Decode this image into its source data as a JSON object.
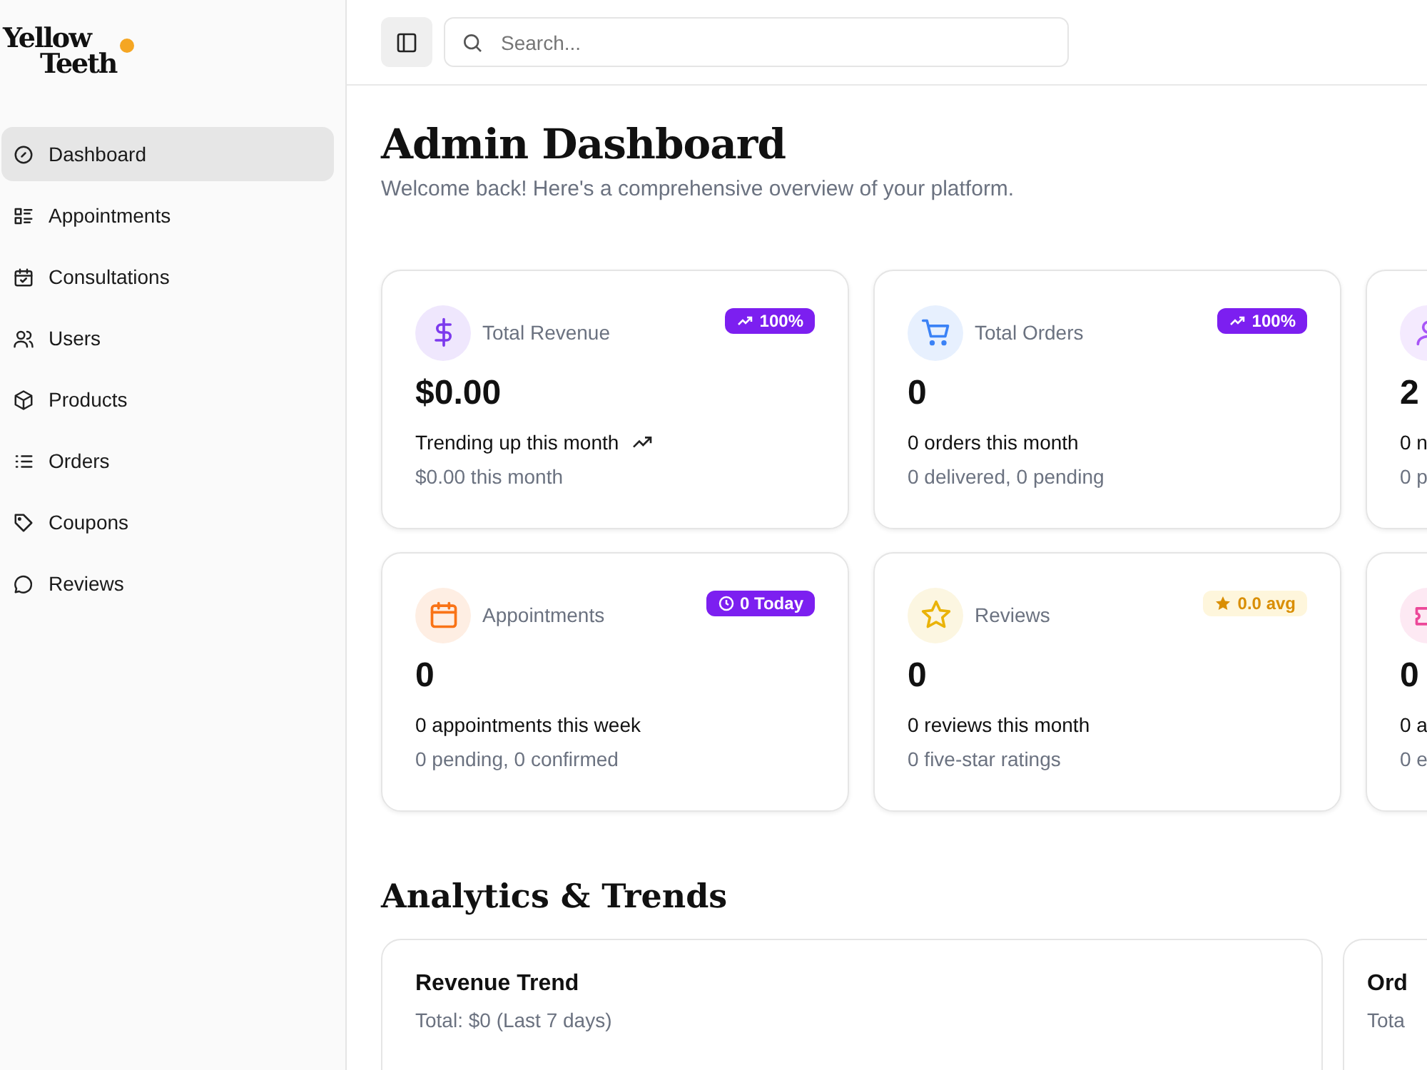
{
  "logo": {
    "line1": "Yellow",
    "line2": "Teeth"
  },
  "sidebar": {
    "items": [
      {
        "label": "Dashboard",
        "selected": true
      },
      {
        "label": "Appointments",
        "selected": false
      },
      {
        "label": "Consultations",
        "selected": false
      },
      {
        "label": "Users",
        "selected": false
      },
      {
        "label": "Products",
        "selected": false
      },
      {
        "label": "Orders",
        "selected": false
      },
      {
        "label": "Coupons",
        "selected": false
      },
      {
        "label": "Reviews",
        "selected": false
      }
    ]
  },
  "search": {
    "placeholder": "Search..."
  },
  "page": {
    "title": "Admin Dashboard",
    "subtitle": "Welcome back! Here's a comprehensive overview of your platform."
  },
  "stat_cards": [
    {
      "label": "Total Revenue",
      "color": "#7c3aed",
      "value": "$0.00",
      "line": "Trending up this month",
      "note": "$0.00 this month",
      "badge": {
        "kind": "solid",
        "text": "100%"
      }
    },
    {
      "label": "Total Orders",
      "color": "#3b82f6",
      "value": "0",
      "line": "0 orders this month",
      "note": "0 delivered, 0 pending",
      "badge": {
        "kind": "solid",
        "text": "100%"
      }
    },
    {
      "color": "#a855f7",
      "value": "2",
      "line": "0 n",
      "note": "0 p"
    },
    {
      "label": "Appointments",
      "color": "#f97316",
      "value": "0",
      "line": "0 appointments this week",
      "note": "0 pending, 0 confirmed",
      "badge": {
        "kind": "solid",
        "text": "0 Today"
      }
    },
    {
      "label": "Reviews",
      "color": "#eab308",
      "value": "0",
      "line": "0 reviews this month",
      "note": "0 five-star ratings",
      "badge": {
        "kind": "soft",
        "text": "0.0 avg"
      }
    },
    {
      "color": "#ec4899",
      "value": "0",
      "line": "0 a",
      "note": "0 e"
    }
  ],
  "analytics": {
    "title": "Analytics & Trends",
    "cards": [
      {
        "title": "Revenue Trend",
        "subtitle": "Total: $0 (Last 7 days)"
      },
      {
        "title": "Ord",
        "subtitle": "Tota"
      }
    ]
  }
}
